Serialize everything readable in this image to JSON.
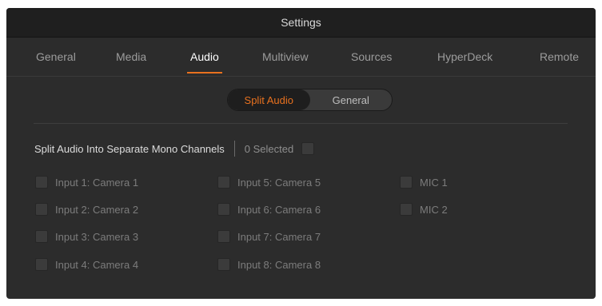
{
  "window": {
    "title": "Settings"
  },
  "tabs": [
    {
      "label": "General",
      "active": false
    },
    {
      "label": "Media",
      "active": false
    },
    {
      "label": "Audio",
      "active": true
    },
    {
      "label": "Multiview",
      "active": false
    },
    {
      "label": "Sources",
      "active": false
    },
    {
      "label": "HyperDeck",
      "active": false
    },
    {
      "label": "Remote",
      "active": false
    }
  ],
  "segments": [
    {
      "label": "Split Audio",
      "active": true
    },
    {
      "label": "General",
      "active": false
    }
  ],
  "split": {
    "label": "Split Audio Into Separate Mono Channels",
    "selected_text": "0 Selected"
  },
  "inputs": {
    "col1": [
      "Input 1: Camera 1",
      "Input 2: Camera 2",
      "Input 3: Camera 3",
      "Input 4: Camera 4"
    ],
    "col2": [
      "Input 5: Camera 5",
      "Input 6: Camera 6",
      "Input 7: Camera 7",
      "Input 8: Camera 8"
    ],
    "col3": [
      "MIC 1",
      "MIC 2"
    ]
  },
  "colors": {
    "accent": "#e8711f",
    "panel": "#2c2c2c",
    "titlebar": "#1f1f1f"
  }
}
